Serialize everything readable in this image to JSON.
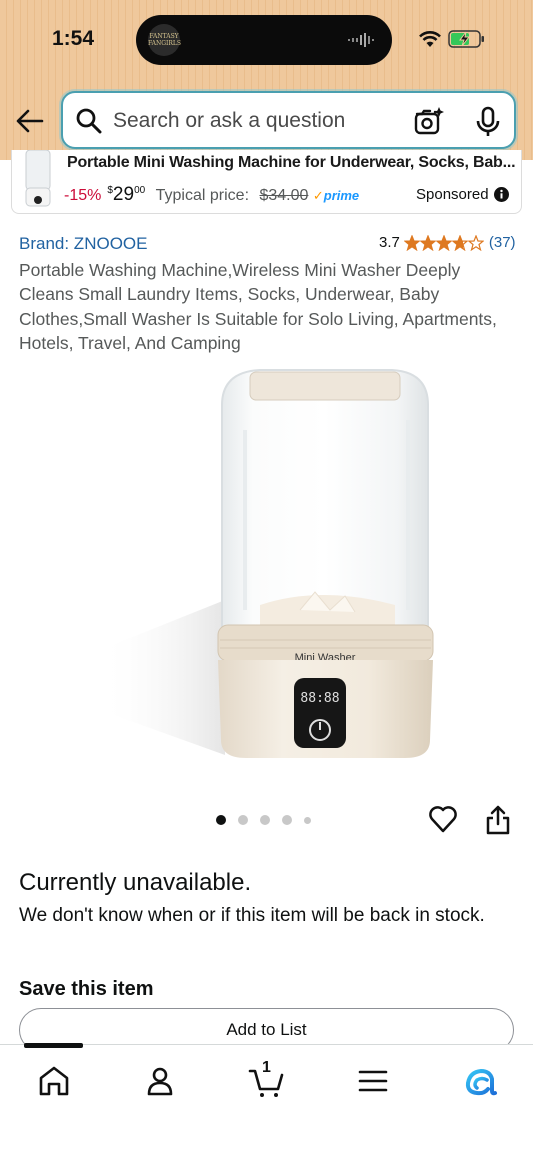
{
  "status_bar": {
    "time": "1:54",
    "island_logo_text": "FANTASY FANGIRLS"
  },
  "search": {
    "placeholder": "Search or ask a question"
  },
  "sponsored": {
    "title": "Portable Mini Washing Machine for Underwear, Socks, Bab...",
    "discount": "-15%",
    "price_symbol": "$",
    "price_whole": "29",
    "price_fraction": "00",
    "typical_label": "Typical price:",
    "typical_price": "$34.00",
    "prime_check": "✓",
    "prime": "prime",
    "label": "Sponsored"
  },
  "product": {
    "brand": "Brand: ZNOOOE",
    "rating": "3.7",
    "rating_value": 3.7,
    "review_count": "(37)",
    "title": "Portable Washing Machine,Wireless Mini Washer Deeply Cleans Small Laundry Items, Socks, Underwear, Baby Clothes,Small Washer Is Suitable for Solo Living, Apartments, Hotels, Travel, And Camping",
    "image_label": "Mini Washer",
    "display_digits": "88:88",
    "image_count": 5,
    "active_image": 1
  },
  "availability": {
    "status": "Currently unavailable.",
    "description": "We don't know when or if this item will be back in stock."
  },
  "save": {
    "heading": "Save this item",
    "add_to_list": "Add to List"
  },
  "bottom_nav": {
    "items": [
      "home-icon",
      "account-icon",
      "cart-icon",
      "menu-icon",
      "rufus-icon"
    ],
    "cart_count": "1"
  },
  "colors": {
    "header_bg": "#efc89c",
    "link": "#2162a1",
    "discount": "#cc0c39",
    "star": "#de7921",
    "prime": "#1a98ff"
  }
}
